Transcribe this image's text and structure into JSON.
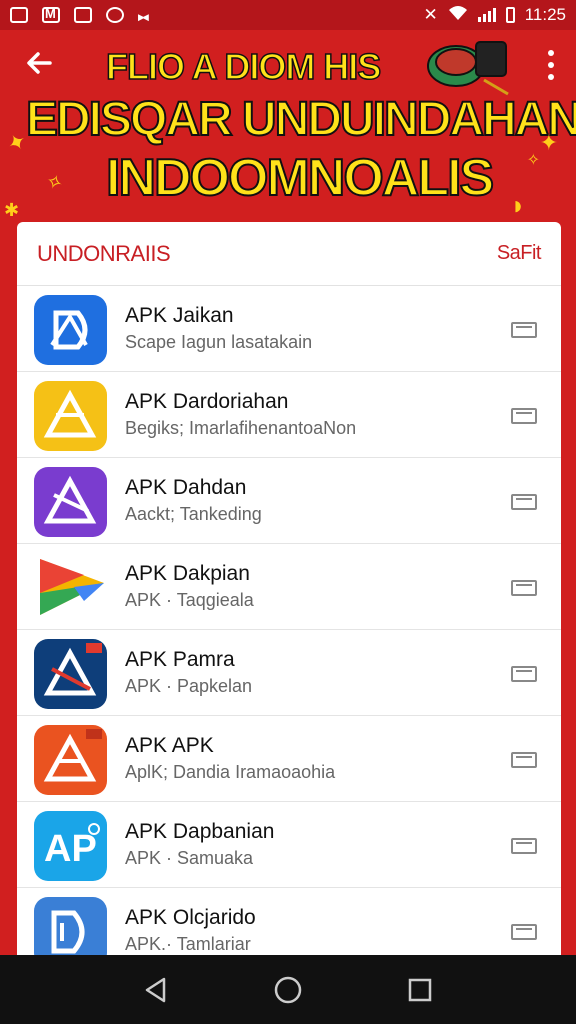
{
  "status_bar": {
    "time": "11:25"
  },
  "header": {
    "line1": "FLIO A DIOM HIS",
    "line2": "EDISQAR UNDUINDAHAN",
    "line3": "INDOOMNOALIS"
  },
  "list_header": {
    "title": "UNDONRAIIS",
    "action": "SaFit"
  },
  "apps": [
    {
      "name": "APK Jaikan",
      "subtitle": "Scape  Iagun lasatakain",
      "icon": "app-icon-blue-d",
      "color": "#1f6fe0"
    },
    {
      "name": "APK Dardoriahan",
      "subtitle": "Begiks; ImarlafihenantoaNon",
      "icon": "app-icon-yellow-triangle",
      "color": "#f5c116"
    },
    {
      "name": "APK Dahdan",
      "subtitle": "Aackt; Tankeding",
      "icon": "app-icon-purple-triangle",
      "color": "#7a3ccf"
    },
    {
      "name": "APK Dakpian",
      "subtitle": "APK · Taqgieala",
      "icon": "app-icon-play-store",
      "color": "#ffffff"
    },
    {
      "name": "APK Pamra",
      "subtitle": "APK · Papkelan",
      "icon": "app-icon-navy-triangle",
      "color": "#0e3e7a"
    },
    {
      "name": "APK APK",
      "subtitle": "AplK; Dandia Iramaoaohia",
      "icon": "app-icon-orange-triangle",
      "color": "#ea5320"
    },
    {
      "name": "APK Dapbanian",
      "subtitle": "APK · Samuaka",
      "icon": "app-icon-blue-ap",
      "color": "#1aa5e8"
    },
    {
      "name": "APK Olcjarido",
      "subtitle": "APK.· Tamlariar",
      "icon": "app-icon-blue-db",
      "color": "#3a7fd6"
    }
  ],
  "colors": {
    "primary": "#d11f1f",
    "accent": "#ffe21a",
    "list_title": "#c81f24"
  }
}
